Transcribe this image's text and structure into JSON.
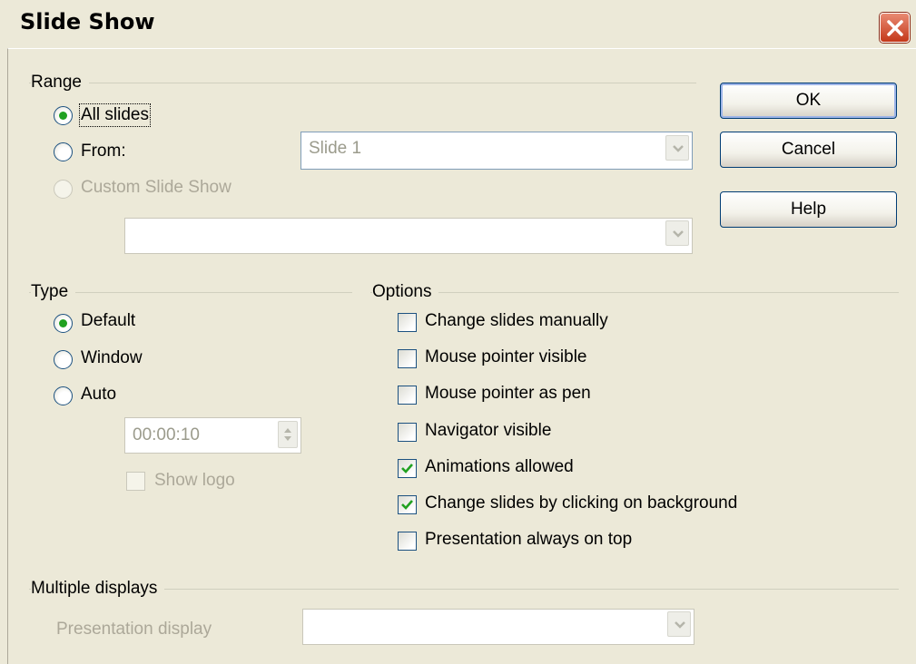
{
  "window": {
    "title": "Slide Show"
  },
  "colors": {
    "radio_selected": "#21a121",
    "checkmark": "#21a121",
    "close_button": "#c4381a",
    "disabled_text": "#aca899"
  },
  "range": {
    "heading": "Range",
    "all_slides": {
      "label": "All slides",
      "selected": true
    },
    "from": {
      "label": "From:",
      "selected": false,
      "value": "Slide 1"
    },
    "custom_slide_show": {
      "label": "Custom Slide Show",
      "enabled": false,
      "value": ""
    }
  },
  "buttons": {
    "ok": "OK",
    "cancel": "Cancel",
    "help": "Help"
  },
  "type": {
    "heading": "Type",
    "default": {
      "label": "Default",
      "selected": true
    },
    "window": {
      "label": "Window",
      "selected": false
    },
    "auto": {
      "label": "Auto",
      "selected": false,
      "duration": "00:00:10"
    },
    "show_logo": {
      "label": "Show logo",
      "checked": false,
      "enabled": false
    }
  },
  "options": {
    "heading": "Options",
    "items": [
      {
        "label": "Change slides manually",
        "checked": false
      },
      {
        "label": "Mouse pointer visible",
        "checked": false
      },
      {
        "label": "Mouse pointer as pen",
        "checked": false
      },
      {
        "label": "Navigator visible",
        "checked": false
      },
      {
        "label": "Animations allowed",
        "checked": true
      },
      {
        "label": "Change slides by clicking on background",
        "checked": true
      },
      {
        "label": "Presentation always on top",
        "checked": false
      }
    ]
  },
  "multiple_displays": {
    "heading": "Multiple displays",
    "presentation_display_label": "Presentation display",
    "presentation_display_value": ""
  },
  "icons": {
    "close": "close-icon",
    "dropdown": "chevron-down-icon",
    "spin": "spin-arrows-icon",
    "check": "checkmark-icon"
  }
}
